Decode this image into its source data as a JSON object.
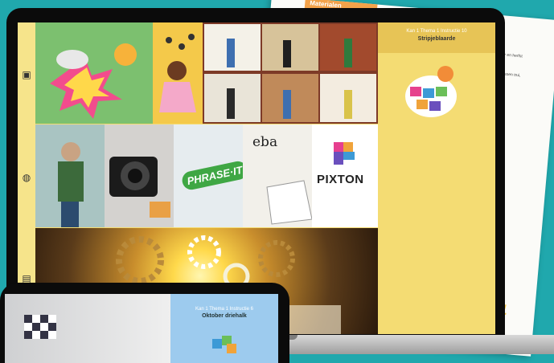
{
  "paper": {
    "tab_label": "Materialen",
    "line1": "ente, zomer en herfst",
    "line2": "ood, das, valwassen trui,",
    "page_number": "1"
  },
  "screen": {
    "strip_icons": [
      "image-icon",
      "globe-icon",
      "document-icon"
    ],
    "tiles": {
      "pixton_label": "PIXTON",
      "phrase_label": "PHRASE·IT",
      "letters": "eba"
    },
    "side": {
      "subtitle": "Kan 1 Thema 1 Instructie 10",
      "title": "Stripjeblaarde"
    }
  },
  "tablet": {
    "subtitle": "Kan 1 Thema 1 Instructie 6",
    "title": "Oktober driehalk"
  }
}
